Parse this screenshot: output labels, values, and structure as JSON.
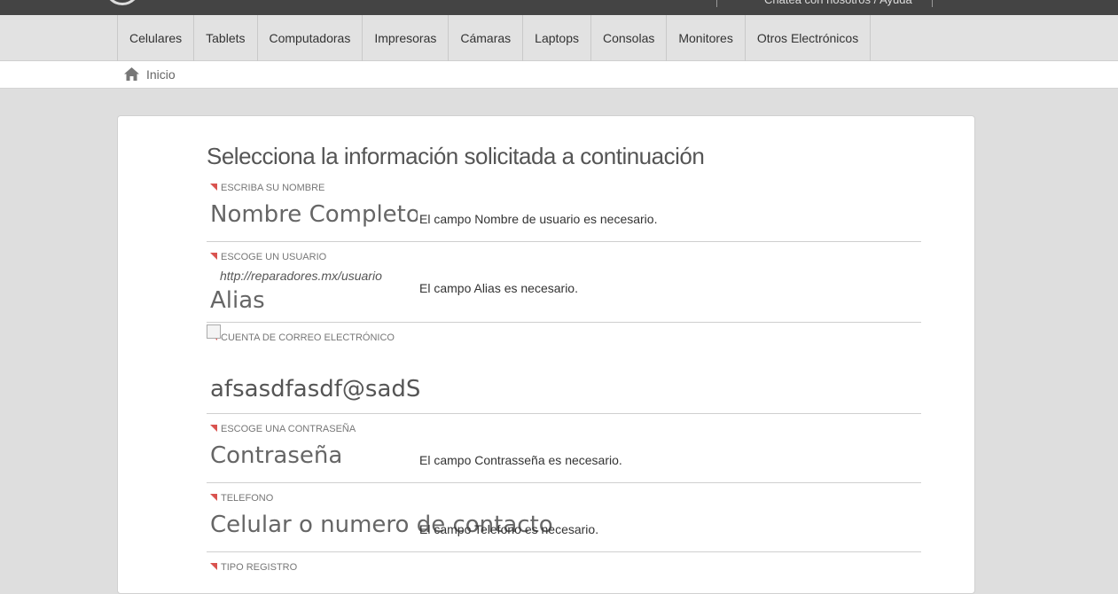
{
  "topbar": {
    "chat_text": "Chatea con nosotros / Ayuda"
  },
  "nav": {
    "categories": [
      "Celulares",
      "Tablets",
      "Computadoras",
      "Impresoras",
      "Cámaras",
      "Laptops",
      "Consolas",
      "Monitores",
      "Otros Electrónicos"
    ]
  },
  "breadcrumb": {
    "home_label": "Inicio"
  },
  "form": {
    "title": "Selecciona la información solicitada a continuación",
    "name": {
      "label": "ESCRIBA SU NOMBRE",
      "placeholder": "Nombre Completo",
      "error": "El campo Nombre de usuario es necesario."
    },
    "user": {
      "label": "ESCOGE UN USUARIO",
      "prefix": "http://reparadores.mx/usuario",
      "placeholder": "Alias",
      "error": "El campo Alias es necesario."
    },
    "email": {
      "label": "CUENTA DE CORREO ELECTRÓNICO",
      "value": "afsasdfasdf@sadS"
    },
    "password": {
      "label": "ESCOGE UNA CONTRASEÑA",
      "placeholder": "Contraseña",
      "error": "El campo Contrasseña es necesario."
    },
    "phone": {
      "label": "TELEFONO",
      "placeholder": "Celular o numero de contacto",
      "error": "El campo Telefono es necesario."
    },
    "registration": {
      "label": "TIPO REGISTRO"
    }
  },
  "colors": {
    "topbar": "#444444",
    "accent_triangle": "#d9534f"
  }
}
